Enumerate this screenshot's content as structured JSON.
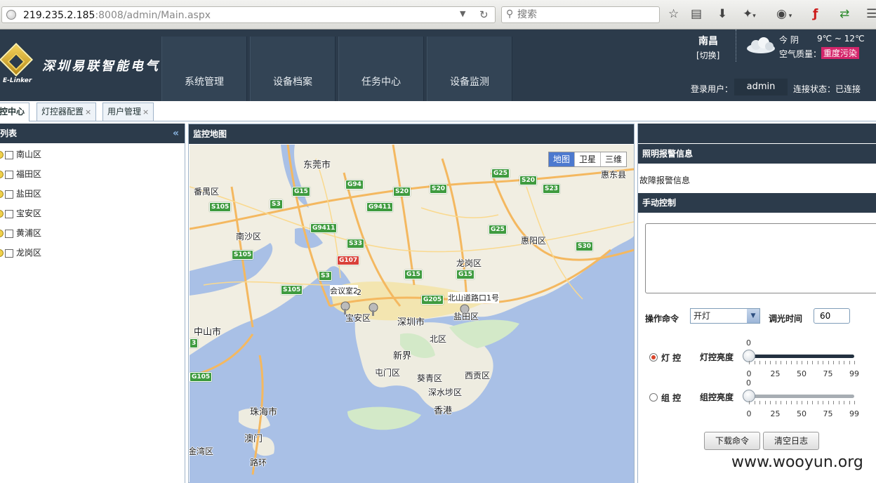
{
  "browser": {
    "url_host": "219.235.2.185",
    "url_rest": ":8008/admin/Main.aspx",
    "search_placeholder": "搜索",
    "toolbar_icons": [
      "star-icon",
      "reading-list-icon",
      "download-icon",
      "extension-icon",
      "addon-icon",
      "flash-icon",
      "sync-icon",
      "menu-icon"
    ]
  },
  "header": {
    "company": "深圳易联智能电气",
    "logo_text": "E-Linker",
    "nav": [
      "系统管理",
      "设备档案",
      "任务中心",
      "设备监测"
    ],
    "city": "南昌",
    "city_switch": "[切换]",
    "weather": {
      "today": "今 阴",
      "temp": "9℃ ~ 12℃",
      "air_label": "空气质量：",
      "air_value": "重度污染",
      "air_color": "#d4266b"
    },
    "login_label": "登录用户：",
    "login_user": "admin",
    "connection": "连接状态：已连接"
  },
  "tabs": [
    {
      "label": "控中心",
      "closable": false
    },
    {
      "label": "灯控器配置",
      "closable": true
    },
    {
      "label": "用户管理",
      "closable": true
    }
  ],
  "tab_close": "×",
  "left_panel": {
    "title": "列表",
    "collapse": "«",
    "districts": [
      "南山区",
      "福田区",
      "盐田区",
      "宝安区",
      "黄浦区",
      "龙岗区"
    ]
  },
  "map_panel": {
    "title": "监控地图",
    "map_types": [
      "地图",
      "卫星",
      "三维"
    ],
    "labels": {
      "dongguan": "东莞市",
      "huidong": "惠东县",
      "panyu": "番禺区",
      "nansha": "南沙区",
      "huiyang": "惠阳区",
      "longgang": "龙岗区",
      "baoan": "宝安区",
      "shenzhen": "深圳市",
      "yantian": "盐田区",
      "beiqu": "北区",
      "xinjie": "新界",
      "zhongshan": "中山市",
      "tunmen": "屯门区",
      "kuiqing": "葵青区",
      "xigong": "西贡区",
      "shenshuibu": "深水埗区",
      "hongkong": "香港",
      "zhuhai": "珠海市",
      "macau": "澳门",
      "luhuan": "路环",
      "jinwan": "金湾区",
      "marker1": "会议室2",
      "marker1_num": "2",
      "marker2": "北山道路口1号"
    },
    "roads": [
      "S105",
      "S3",
      "G15",
      "G94",
      "S20",
      "S20",
      "G25",
      "S20",
      "S23",
      "G9411",
      "G9411",
      "S33",
      "G107",
      "G15",
      "G15",
      "G25",
      "S30",
      "S105",
      "S105",
      "S3",
      "G205",
      "G105",
      "3"
    ]
  },
  "right_panel": {
    "alarm_title": "照明报警信息",
    "alarm_text": "故障报警信息",
    "manual_title": "手动控制",
    "op_label": "操作命令",
    "op_value": "开灯",
    "dim_label": "调光时间",
    "dim_value": "60",
    "lamp_label": "灯 控",
    "lamp_brightness_label": "灯控亮度",
    "lamp_brightness": 0,
    "group_label": "组 控",
    "group_brightness_label": "组控亮度",
    "group_brightness": 0,
    "tick_labels": [
      "0",
      "25",
      "50",
      "75",
      "99"
    ],
    "download_btn": "下载命令",
    "clear_btn": "清空日志"
  },
  "watermark": "www.wooyun.org"
}
